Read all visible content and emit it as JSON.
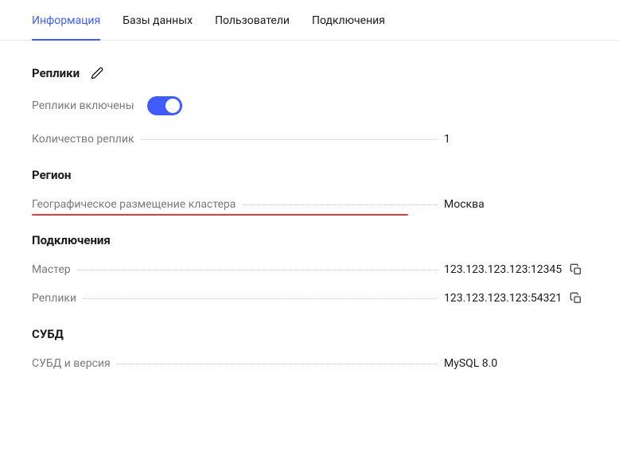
{
  "tabs": [
    {
      "label": "Информация",
      "active": true
    },
    {
      "label": "Базы данных",
      "active": false
    },
    {
      "label": "Пользователи",
      "active": false
    },
    {
      "label": "Подключения",
      "active": false
    }
  ],
  "sections": {
    "replicas": {
      "title": "Реплики",
      "toggle_label": "Реплики включены",
      "toggle_on": true,
      "count_label": "Количество реплик",
      "count_value": "1"
    },
    "region": {
      "title": "Регион",
      "location_label": "Географическое размещение кластера",
      "location_value": "Москва"
    },
    "connections": {
      "title": "Подключения",
      "master_label": "Мастер",
      "master_value": "123.123.123.123:12345",
      "replicas_label": "Реплики",
      "replicas_value": "123.123.123.123:54321"
    },
    "dbms": {
      "title": "СУБД",
      "version_label": "СУБД и версия",
      "version_value": "MySQL 8.0"
    }
  }
}
